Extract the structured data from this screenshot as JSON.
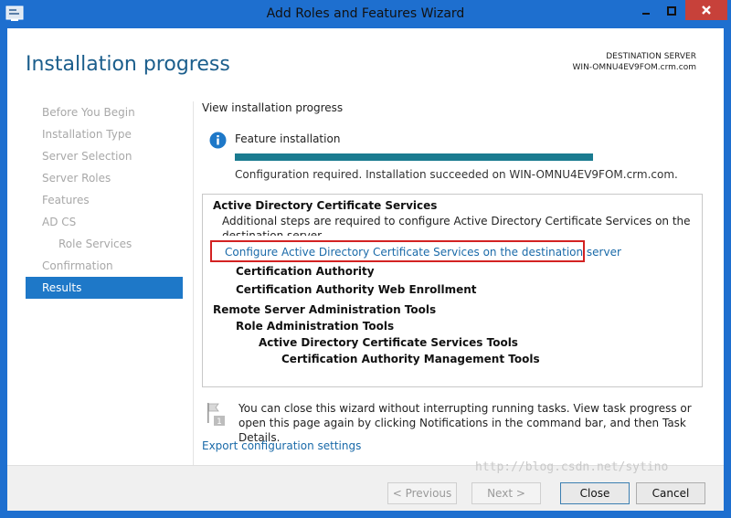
{
  "window": {
    "title": "Add Roles and Features Wizard"
  },
  "header": {
    "title": "Installation progress",
    "destination_label": "DESTINATION SERVER",
    "destination_server": "WIN-OMNU4EV9FOM.crm.com"
  },
  "nav": {
    "items": [
      {
        "label": "Before You Begin",
        "state": "inactive"
      },
      {
        "label": "Installation Type",
        "state": "inactive"
      },
      {
        "label": "Server Selection",
        "state": "inactive"
      },
      {
        "label": "Server Roles",
        "state": "inactive"
      },
      {
        "label": "Features",
        "state": "inactive"
      },
      {
        "label": "AD CS",
        "state": "inactive"
      },
      {
        "label": "Role Services",
        "state": "inactive"
      },
      {
        "label": "Confirmation",
        "state": "inactive"
      },
      {
        "label": "Results",
        "state": "active"
      }
    ]
  },
  "content": {
    "section_label": "View installation progress",
    "feature_label": "Feature installation",
    "progress_percent": 100,
    "status_text": "Configuration required. Installation succeeded on WIN-OMNU4EV9FOM.crm.com.",
    "results": {
      "adcs_title": "Active Directory Certificate Services",
      "adcs_note": "Additional steps are required to configure Active Directory Certificate Services on the destination server",
      "config_link": "Configure Active Directory Certificate Services on the destination server",
      "cert_authority": "Certification Authority",
      "cert_web_enrollment": "Certification Authority Web Enrollment",
      "rsat_title": "Remote Server Administration Tools",
      "role_admin_tools": "Role Administration Tools",
      "adcs_tools": "Active Directory Certificate Services Tools",
      "ca_mgmt_tools": "Certification Authority Management Tools"
    },
    "tip_text": "You can close this wizard without interrupting running tasks. View task progress or open this page again by clicking Notifications in the command bar, and then Task Details.",
    "flag_badge": "1",
    "export_link": "Export configuration settings"
  },
  "footer": {
    "previous_label": "< Previous",
    "next_label": "Next >",
    "close_label": "Close",
    "cancel_label": "Cancel"
  },
  "watermark": "http://blog.csdn.net/sytino",
  "colors": {
    "titlebar": "#1e6fcf",
    "header_title": "#1b5e8c",
    "nav_active": "#1e78c8",
    "progress_fill": "#1a7b90",
    "link": "#1a6aa9",
    "highlight_border": "#d32222"
  }
}
